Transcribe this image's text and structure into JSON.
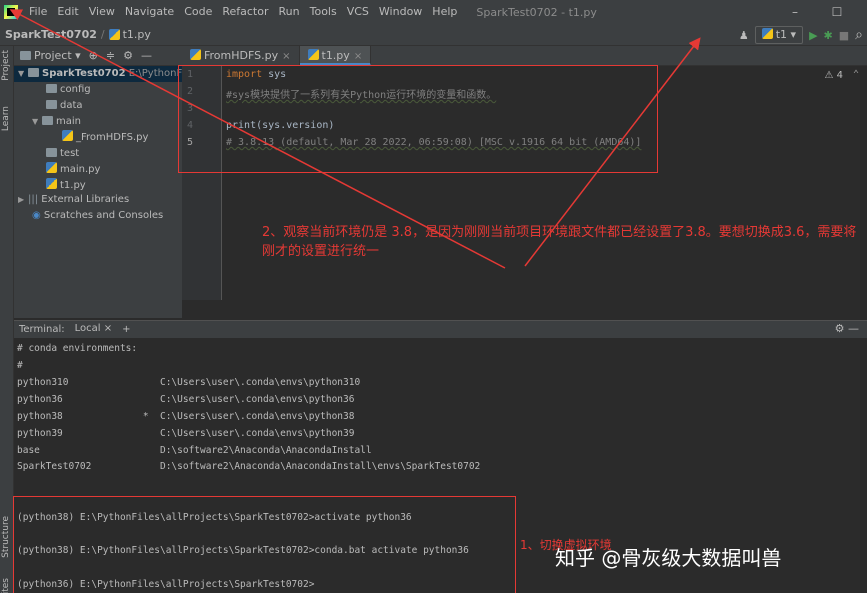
{
  "menu": {
    "items": [
      "File",
      "Edit",
      "View",
      "Navigate",
      "Code",
      "Refactor",
      "Run",
      "Tools",
      "VCS",
      "Window",
      "Help"
    ],
    "window_title": "SparkTest0702 - t1.py",
    "minimize": "–",
    "maximize": "☐"
  },
  "breadcrumb": {
    "project": "SparkTest0702",
    "file": "t1.py"
  },
  "toolbar": {
    "run_config": "t1",
    "run_icon": "▶",
    "debug_icon": "✱",
    "stop_icon": "■",
    "search_icon": "⌕",
    "account_icon": "♟"
  },
  "project_panel": {
    "header": "Project",
    "tree": [
      {
        "label": "SparkTest0702",
        "extra": "E:\\PythonFiles",
        "type": "folder-root"
      },
      {
        "label": "config",
        "type": "folder"
      },
      {
        "label": "data",
        "type": "folder"
      },
      {
        "label": "main",
        "type": "folder"
      },
      {
        "label": "_FromHDFS.py",
        "type": "py"
      },
      {
        "label": "test",
        "type": "folder"
      },
      {
        "label": "main.py",
        "type": "py"
      },
      {
        "label": "t1.py",
        "type": "py"
      },
      {
        "label": "External Libraries",
        "type": "lib"
      },
      {
        "label": "Scratches and Consoles",
        "type": "scratch"
      }
    ]
  },
  "side_labels": {
    "project": "Project",
    "learn": "Learn",
    "structure": "Structure",
    "favorites": "Favorites"
  },
  "editor_tabs": [
    {
      "label": "FromHDFS.py"
    },
    {
      "label": "t1.py"
    }
  ],
  "editor": {
    "line_numbers": [
      "1",
      "2",
      "3",
      "4",
      "5"
    ],
    "lines": {
      "l1_kw": "import",
      "l1_rest": " sys",
      "l2": "#sys模块提供了一系列有关Python运行环境的变量和函数。",
      "l3": "",
      "l4_fn": "print",
      "l4_rest": "(sys.version)",
      "l5": "# 3.8.13 (default, Mar 28 2022, 06:59:08) [MSC v.1916 64 bit (AMD64)]"
    },
    "inspection": "⚠ 4"
  },
  "terminal": {
    "tabs": [
      "Terminal:",
      "Local"
    ],
    "add": "+",
    "lines": [
      "# conda environments:",
      "#",
      "python310                C:\\Users\\user\\.conda\\envs\\python310",
      "python36                 C:\\Users\\user\\.conda\\envs\\python36",
      "python38              *  C:\\Users\\user\\.conda\\envs\\python38",
      "python39                 C:\\Users\\user\\.conda\\envs\\python39",
      "base                     D:\\software2\\Anaconda\\AnacondaInstall",
      "SparkTest0702            D:\\software2\\Anaconda\\AnacondaInstall\\envs\\SparkTest0702",
      "(python38) E:\\PythonFiles\\allProjects\\SparkTest0702>activate python36",
      "(python38) E:\\PythonFiles\\allProjects\\SparkTest0702>conda.bat activate python36",
      "(python36) E:\\PythonFiles\\allProjects\\SparkTest0702>"
    ]
  },
  "annotations": {
    "note2": "2、观察当前环境仍是 3.8，是因为刚刚当前项目环境跟文件都已经设置了3.8。要想切换成3.6，需要将刚才的设置进行统一",
    "note1": "1、切换虚拟环境"
  },
  "watermark": "知乎 @骨灰级大数据叫兽",
  "colors": {
    "annotation_red": "#e53935",
    "keyword": "#cc7832",
    "comment": "#808080"
  }
}
